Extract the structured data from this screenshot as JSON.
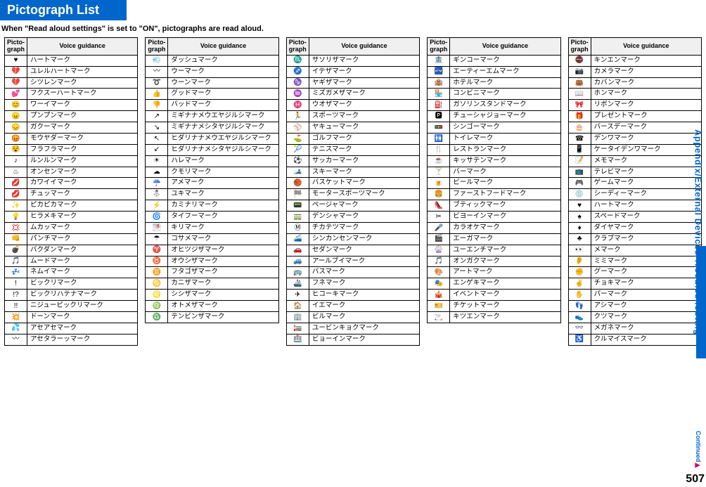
{
  "title": "Pictograph List",
  "subtitle": "When \"Read aloud settings\" is set to \"ON\", pictographs are read aloud.",
  "headers": {
    "picto": "Picto-\ngraph",
    "voice": "Voice guidance"
  },
  "side_tab": "Appendix/External Devices/Troubleshooting",
  "continued": "Continued",
  "page_num": "507",
  "columns": [
    [
      {
        "i": "♥",
        "v": "ハートマーク"
      },
      {
        "i": "💔",
        "v": "ユレルハートマーク"
      },
      {
        "i": "💔",
        "v": "シツレンマーク"
      },
      {
        "i": "💕",
        "v": "フクスーハートマーク"
      },
      {
        "i": "😊",
        "v": "ワーイマーク"
      },
      {
        "i": "😠",
        "v": "プンプンマーク"
      },
      {
        "i": "😞",
        "v": "ガクーマーク"
      },
      {
        "i": "😡",
        "v": "モウヤダーマーク"
      },
      {
        "i": "😵",
        "v": "フラフラマーク"
      },
      {
        "i": "♪",
        "v": "ルンルンマーク"
      },
      {
        "i": "♨",
        "v": "オンセンマーク"
      },
      {
        "i": "💋",
        "v": "カワイイマーク"
      },
      {
        "i": "💋",
        "v": "チュッマーク"
      },
      {
        "i": "✨",
        "v": "ピカピカマーク"
      },
      {
        "i": "💡",
        "v": "ヒラメキマーク"
      },
      {
        "i": "💢",
        "v": "ムカッマーク"
      },
      {
        "i": "👊",
        "v": "パンチマーク"
      },
      {
        "i": "💣",
        "v": "バクダンマーク"
      },
      {
        "i": "🎵",
        "v": "ムードマーク"
      },
      {
        "i": "💤",
        "v": "ネムイマーク"
      },
      {
        "i": "!",
        "v": "ビックリマーク"
      },
      {
        "i": "!?",
        "v": "ビックリハテナマーク"
      },
      {
        "i": "!!",
        "v": "ニジューピックリマーク"
      },
      {
        "i": "💥",
        "v": "ドーンマーク"
      },
      {
        "i": "💦",
        "v": "アセアセマーク"
      },
      {
        "i": "〰",
        "v": "アセタラーッマーク"
      }
    ],
    [
      {
        "i": "💨",
        "v": "ダッシュマーク"
      },
      {
        "i": "〰",
        "v": "ウーマーク"
      },
      {
        "i": "➰",
        "v": "ウーンマーク"
      },
      {
        "i": "👍",
        "v": "グッドマーク"
      },
      {
        "i": "👎",
        "v": "バッドマーク"
      },
      {
        "i": "↗",
        "v": "ミギナナメウエヤジルシマーク"
      },
      {
        "i": "↘",
        "v": "ミギナナメシタヤジルシマーク"
      },
      {
        "i": "↖",
        "v": "ヒダリナナメウエヤジルシマーク"
      },
      {
        "i": "↙",
        "v": "ヒダリナナメシタヤジルシマーク"
      },
      {
        "i": "☀",
        "v": "ハレマーク"
      },
      {
        "i": "☁",
        "v": "クモリマーク"
      },
      {
        "i": "☔",
        "v": "アメマーク"
      },
      {
        "i": "⛄",
        "v": "ユキマーク"
      },
      {
        "i": "⚡",
        "v": "カミナリマーク"
      },
      {
        "i": "🌀",
        "v": "タイフーマーク"
      },
      {
        "i": "🌁",
        "v": "キリマーク"
      },
      {
        "i": "☂",
        "v": "コサメマーク"
      },
      {
        "i": "♈",
        "v": "オヒツジザマーク"
      },
      {
        "i": "♉",
        "v": "オウシザマーク"
      },
      {
        "i": "♊",
        "v": "フタゴザマーク"
      },
      {
        "i": "♋",
        "v": "カニザマーク"
      },
      {
        "i": "♌",
        "v": "シシザマーク"
      },
      {
        "i": "♍",
        "v": "オトメザマーク"
      },
      {
        "i": "♎",
        "v": "テンビンザマーク"
      }
    ],
    [
      {
        "i": "♏",
        "v": "サソリザマーク"
      },
      {
        "i": "♐",
        "v": "イテザマーク"
      },
      {
        "i": "♑",
        "v": "ヤギザマーク"
      },
      {
        "i": "♒",
        "v": "ミズガメザマーク"
      },
      {
        "i": "♓",
        "v": "ウオザマーク"
      },
      {
        "i": "🏃",
        "v": "スポーツマーク"
      },
      {
        "i": "⚾",
        "v": "ヤキューマーク"
      },
      {
        "i": "⛳",
        "v": "ゴルフマーク"
      },
      {
        "i": "🎾",
        "v": "テニスマーク"
      },
      {
        "i": "⚽",
        "v": "サッカーマーク"
      },
      {
        "i": "🎿",
        "v": "スキーマーク"
      },
      {
        "i": "🏀",
        "v": "バスケットマーク"
      },
      {
        "i": "🏁",
        "v": "モータースポーツマーク"
      },
      {
        "i": "📟",
        "v": "ページャマーク"
      },
      {
        "i": "🚃",
        "v": "デンシャマーク"
      },
      {
        "i": "Ⓜ",
        "v": "チカテツマーク"
      },
      {
        "i": "🚄",
        "v": "シンカンセンマーク"
      },
      {
        "i": "🚗",
        "v": "セダンマーク"
      },
      {
        "i": "🚙",
        "v": "アールブイマーク"
      },
      {
        "i": "🚌",
        "v": "バスマーク"
      },
      {
        "i": "🚢",
        "v": "フネマーク"
      },
      {
        "i": "✈",
        "v": "ヒコーキマーク"
      },
      {
        "i": "🏠",
        "v": "イエマーク"
      },
      {
        "i": "🏢",
        "v": "ビルマーク"
      },
      {
        "i": "🏣",
        "v": "ユービンキョクマーク"
      },
      {
        "i": "🏥",
        "v": "ビョーインマーク"
      }
    ],
    [
      {
        "i": "🏦",
        "v": "ギンコーマーク"
      },
      {
        "i": "🏧",
        "v": "エーティーエムマーク"
      },
      {
        "i": "🏨",
        "v": "ホテルマーク"
      },
      {
        "i": "🏪",
        "v": "コンビニマーク"
      },
      {
        "i": "⛽",
        "v": "ガソリンスタンドマーク"
      },
      {
        "i": "🅿",
        "v": "チューシャジョーマーク"
      },
      {
        "i": "🚥",
        "v": "シンゴーマーク"
      },
      {
        "i": "🚻",
        "v": "トイレマーク"
      },
      {
        "i": "🍴",
        "v": "レストランマーク"
      },
      {
        "i": "☕",
        "v": "キッサテンマーク"
      },
      {
        "i": "🍸",
        "v": "バーマーク"
      },
      {
        "i": "🍺",
        "v": "ビールマーク"
      },
      {
        "i": "🍔",
        "v": "ファーストフードマーク"
      },
      {
        "i": "👠",
        "v": "ブティックマーク"
      },
      {
        "i": "✂",
        "v": "ビヨーインマーク"
      },
      {
        "i": "🎤",
        "v": "カラオケマーク"
      },
      {
        "i": "🎬",
        "v": "エーガマーク"
      },
      {
        "i": "🎡",
        "v": "ユーエンチマーク"
      },
      {
        "i": "🎵",
        "v": "オンガクマーク"
      },
      {
        "i": "🎨",
        "v": "アートマーク"
      },
      {
        "i": "🎭",
        "v": "エンゲキマーク"
      },
      {
        "i": "🎪",
        "v": "イベントマーク"
      },
      {
        "i": "🎫",
        "v": "チケットマーク"
      },
      {
        "i": "🚬",
        "v": "キツエンマーク"
      }
    ],
    [
      {
        "i": "🚭",
        "v": "キンエンマーク"
      },
      {
        "i": "📷",
        "v": "カメラマーク"
      },
      {
        "i": "👜",
        "v": "カバンマーク"
      },
      {
        "i": "📖",
        "v": "ホンマーク"
      },
      {
        "i": "🎀",
        "v": "リボンマーク"
      },
      {
        "i": "🎁",
        "v": "プレゼントマーク"
      },
      {
        "i": "🎂",
        "v": "バースデーマーク"
      },
      {
        "i": "☎",
        "v": "デンワマーク"
      },
      {
        "i": "📱",
        "v": "ケータイデンワマーク"
      },
      {
        "i": "📝",
        "v": "メモマーク"
      },
      {
        "i": "📺",
        "v": "テレビマーク"
      },
      {
        "i": "🎮",
        "v": "ゲームマーク"
      },
      {
        "i": "💿",
        "v": "シーディーマーク"
      },
      {
        "i": "♥",
        "v": "ハートマーク"
      },
      {
        "i": "♠",
        "v": "スペードマーク"
      },
      {
        "i": "♦",
        "v": "ダイヤマーク"
      },
      {
        "i": "♣",
        "v": "クラブマーク"
      },
      {
        "i": "👀",
        "v": "メマーク"
      },
      {
        "i": "👂",
        "v": "ミミマーク"
      },
      {
        "i": "✊",
        "v": "グーマーク"
      },
      {
        "i": "✌",
        "v": "チョキマーク"
      },
      {
        "i": "✋",
        "v": "パーマーク"
      },
      {
        "i": "👣",
        "v": "アシマーク"
      },
      {
        "i": "👟",
        "v": "クツマーク"
      },
      {
        "i": "👓",
        "v": "メガネマーク"
      },
      {
        "i": "♿",
        "v": "クルマイスマーク"
      }
    ]
  ]
}
